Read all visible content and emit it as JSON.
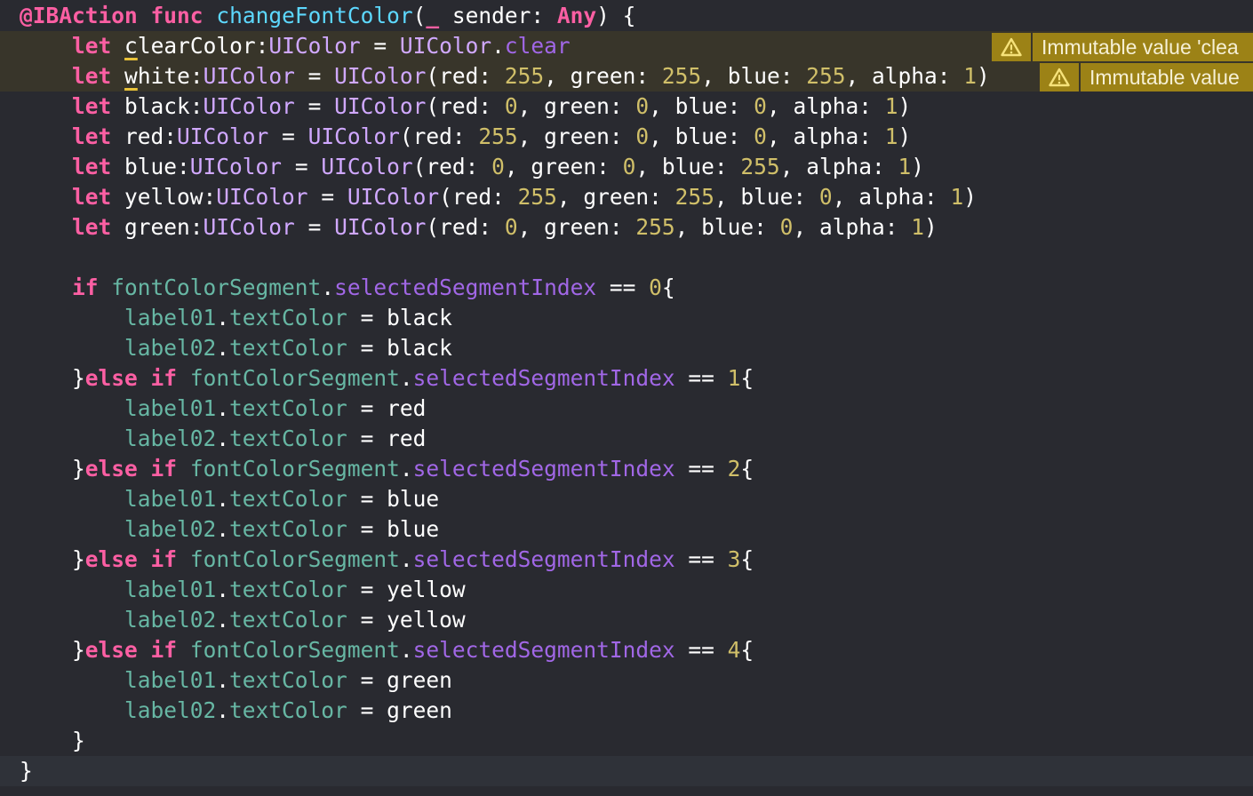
{
  "editor": {
    "lines": [
      [
        {
          "t": "@IBAction",
          "c": "attr"
        },
        {
          "t": " ",
          "c": "plain"
        },
        {
          "t": "func",
          "c": "kw"
        },
        {
          "t": " ",
          "c": "plain"
        },
        {
          "t": "changeFontColor",
          "c": "decl"
        },
        {
          "t": "(",
          "c": "plain"
        },
        {
          "t": "_",
          "c": "kw"
        },
        {
          "t": " sender: ",
          "c": "plain"
        },
        {
          "t": "Any",
          "c": "kw"
        },
        {
          "t": ") {",
          "c": "plain"
        }
      ],
      [
        {
          "t": "    ",
          "c": "plain"
        },
        {
          "t": "let",
          "c": "kw"
        },
        {
          "t": " ",
          "c": "plain"
        },
        {
          "t": "c",
          "c": "u"
        },
        {
          "t": "learColor:",
          "c": "plain"
        },
        {
          "t": "UIColor",
          "c": "type"
        },
        {
          "t": " = ",
          "c": "plain"
        },
        {
          "t": "UIColor",
          "c": "type"
        },
        {
          "t": ".",
          "c": "plain"
        },
        {
          "t": "clear",
          "c": "prop"
        }
      ],
      [
        {
          "t": "    ",
          "c": "plain"
        },
        {
          "t": "let",
          "c": "kw"
        },
        {
          "t": " ",
          "c": "plain"
        },
        {
          "t": "w",
          "c": "u"
        },
        {
          "t": "hite:",
          "c": "plain"
        },
        {
          "t": "UIColor",
          "c": "type"
        },
        {
          "t": " = ",
          "c": "plain"
        },
        {
          "t": "UIColor",
          "c": "type"
        },
        {
          "t": "(red: ",
          "c": "plain"
        },
        {
          "t": "255",
          "c": "num"
        },
        {
          "t": ", green: ",
          "c": "plain"
        },
        {
          "t": "255",
          "c": "num"
        },
        {
          "t": ", blue: ",
          "c": "plain"
        },
        {
          "t": "255",
          "c": "num"
        },
        {
          "t": ", alpha: ",
          "c": "plain"
        },
        {
          "t": "1",
          "c": "num"
        },
        {
          "t": ")",
          "c": "plain"
        }
      ],
      [
        {
          "t": "    ",
          "c": "plain"
        },
        {
          "t": "let",
          "c": "kw"
        },
        {
          "t": " black:",
          "c": "plain"
        },
        {
          "t": "UIColor",
          "c": "type"
        },
        {
          "t": " = ",
          "c": "plain"
        },
        {
          "t": "UIColor",
          "c": "type"
        },
        {
          "t": "(red: ",
          "c": "plain"
        },
        {
          "t": "0",
          "c": "num"
        },
        {
          "t": ", green: ",
          "c": "plain"
        },
        {
          "t": "0",
          "c": "num"
        },
        {
          "t": ", blue: ",
          "c": "plain"
        },
        {
          "t": "0",
          "c": "num"
        },
        {
          "t": ", alpha: ",
          "c": "plain"
        },
        {
          "t": "1",
          "c": "num"
        },
        {
          "t": ")",
          "c": "plain"
        }
      ],
      [
        {
          "t": "    ",
          "c": "plain"
        },
        {
          "t": "let",
          "c": "kw"
        },
        {
          "t": " red:",
          "c": "plain"
        },
        {
          "t": "UIColor",
          "c": "type"
        },
        {
          "t": " = ",
          "c": "plain"
        },
        {
          "t": "UIColor",
          "c": "type"
        },
        {
          "t": "(red: ",
          "c": "plain"
        },
        {
          "t": "255",
          "c": "num"
        },
        {
          "t": ", green: ",
          "c": "plain"
        },
        {
          "t": "0",
          "c": "num"
        },
        {
          "t": ", blue: ",
          "c": "plain"
        },
        {
          "t": "0",
          "c": "num"
        },
        {
          "t": ", alpha: ",
          "c": "plain"
        },
        {
          "t": "1",
          "c": "num"
        },
        {
          "t": ")",
          "c": "plain"
        }
      ],
      [
        {
          "t": "    ",
          "c": "plain"
        },
        {
          "t": "let",
          "c": "kw"
        },
        {
          "t": " blue:",
          "c": "plain"
        },
        {
          "t": "UIColor",
          "c": "type"
        },
        {
          "t": " = ",
          "c": "plain"
        },
        {
          "t": "UIColor",
          "c": "type"
        },
        {
          "t": "(red: ",
          "c": "plain"
        },
        {
          "t": "0",
          "c": "num"
        },
        {
          "t": ", green: ",
          "c": "plain"
        },
        {
          "t": "0",
          "c": "num"
        },
        {
          "t": ", blue: ",
          "c": "plain"
        },
        {
          "t": "255",
          "c": "num"
        },
        {
          "t": ", alpha: ",
          "c": "plain"
        },
        {
          "t": "1",
          "c": "num"
        },
        {
          "t": ")",
          "c": "plain"
        }
      ],
      [
        {
          "t": "    ",
          "c": "plain"
        },
        {
          "t": "let",
          "c": "kw"
        },
        {
          "t": " yellow:",
          "c": "plain"
        },
        {
          "t": "UIColor",
          "c": "type"
        },
        {
          "t": " = ",
          "c": "plain"
        },
        {
          "t": "UIColor",
          "c": "type"
        },
        {
          "t": "(red: ",
          "c": "plain"
        },
        {
          "t": "255",
          "c": "num"
        },
        {
          "t": ", green: ",
          "c": "plain"
        },
        {
          "t": "255",
          "c": "num"
        },
        {
          "t": ", blue: ",
          "c": "plain"
        },
        {
          "t": "0",
          "c": "num"
        },
        {
          "t": ", alpha: ",
          "c": "plain"
        },
        {
          "t": "1",
          "c": "num"
        },
        {
          "t": ")",
          "c": "plain"
        }
      ],
      [
        {
          "t": "    ",
          "c": "plain"
        },
        {
          "t": "let",
          "c": "kw"
        },
        {
          "t": " green:",
          "c": "plain"
        },
        {
          "t": "UIColor",
          "c": "type"
        },
        {
          "t": " = ",
          "c": "plain"
        },
        {
          "t": "UIColor",
          "c": "type"
        },
        {
          "t": "(red: ",
          "c": "plain"
        },
        {
          "t": "0",
          "c": "num"
        },
        {
          "t": ", green: ",
          "c": "plain"
        },
        {
          "t": "255",
          "c": "num"
        },
        {
          "t": ", blue: ",
          "c": "plain"
        },
        {
          "t": "0",
          "c": "num"
        },
        {
          "t": ", alpha: ",
          "c": "plain"
        },
        {
          "t": "1",
          "c": "num"
        },
        {
          "t": ")",
          "c": "plain"
        }
      ],
      [],
      [
        {
          "t": "    ",
          "c": "plain"
        },
        {
          "t": "if",
          "c": "kw"
        },
        {
          "t": " ",
          "c": "plain"
        },
        {
          "t": "fontColorSegment",
          "c": "var"
        },
        {
          "t": ".",
          "c": "plain"
        },
        {
          "t": "selectedSegmentIndex",
          "c": "prop"
        },
        {
          "t": " == ",
          "c": "plain"
        },
        {
          "t": "0",
          "c": "num"
        },
        {
          "t": "{",
          "c": "plain"
        }
      ],
      [
        {
          "t": "        ",
          "c": "plain"
        },
        {
          "t": "label01",
          "c": "var"
        },
        {
          "t": ".",
          "c": "plain"
        },
        {
          "t": "textColor",
          "c": "var"
        },
        {
          "t": " = black",
          "c": "plain"
        }
      ],
      [
        {
          "t": "        ",
          "c": "plain"
        },
        {
          "t": "label02",
          "c": "var"
        },
        {
          "t": ".",
          "c": "plain"
        },
        {
          "t": "textColor",
          "c": "var"
        },
        {
          "t": " = black",
          "c": "plain"
        }
      ],
      [
        {
          "t": "    }",
          "c": "plain"
        },
        {
          "t": "else",
          "c": "kw"
        },
        {
          "t": " ",
          "c": "plain"
        },
        {
          "t": "if",
          "c": "kw"
        },
        {
          "t": " ",
          "c": "plain"
        },
        {
          "t": "fontColorSegment",
          "c": "var"
        },
        {
          "t": ".",
          "c": "plain"
        },
        {
          "t": "selectedSegmentIndex",
          "c": "prop"
        },
        {
          "t": " == ",
          "c": "plain"
        },
        {
          "t": "1",
          "c": "num"
        },
        {
          "t": "{",
          "c": "plain"
        }
      ],
      [
        {
          "t": "        ",
          "c": "plain"
        },
        {
          "t": "label01",
          "c": "var"
        },
        {
          "t": ".",
          "c": "plain"
        },
        {
          "t": "textColor",
          "c": "var"
        },
        {
          "t": " = red",
          "c": "plain"
        }
      ],
      [
        {
          "t": "        ",
          "c": "plain"
        },
        {
          "t": "label02",
          "c": "var"
        },
        {
          "t": ".",
          "c": "plain"
        },
        {
          "t": "textColor",
          "c": "var"
        },
        {
          "t": " = red",
          "c": "plain"
        }
      ],
      [
        {
          "t": "    }",
          "c": "plain"
        },
        {
          "t": "else",
          "c": "kw"
        },
        {
          "t": " ",
          "c": "plain"
        },
        {
          "t": "if",
          "c": "kw"
        },
        {
          "t": " ",
          "c": "plain"
        },
        {
          "t": "fontColorSegment",
          "c": "var"
        },
        {
          "t": ".",
          "c": "plain"
        },
        {
          "t": "selectedSegmentIndex",
          "c": "prop"
        },
        {
          "t": " == ",
          "c": "plain"
        },
        {
          "t": "2",
          "c": "num"
        },
        {
          "t": "{",
          "c": "plain"
        }
      ],
      [
        {
          "t": "        ",
          "c": "plain"
        },
        {
          "t": "label01",
          "c": "var"
        },
        {
          "t": ".",
          "c": "plain"
        },
        {
          "t": "textColor",
          "c": "var"
        },
        {
          "t": " = blue",
          "c": "plain"
        }
      ],
      [
        {
          "t": "        ",
          "c": "plain"
        },
        {
          "t": "label02",
          "c": "var"
        },
        {
          "t": ".",
          "c": "plain"
        },
        {
          "t": "textColor",
          "c": "var"
        },
        {
          "t": " = blue",
          "c": "plain"
        }
      ],
      [
        {
          "t": "    }",
          "c": "plain"
        },
        {
          "t": "else",
          "c": "kw"
        },
        {
          "t": " ",
          "c": "plain"
        },
        {
          "t": "if",
          "c": "kw"
        },
        {
          "t": " ",
          "c": "plain"
        },
        {
          "t": "fontColorSegment",
          "c": "var"
        },
        {
          "t": ".",
          "c": "plain"
        },
        {
          "t": "selectedSegmentIndex",
          "c": "prop"
        },
        {
          "t": " == ",
          "c": "plain"
        },
        {
          "t": "3",
          "c": "num"
        },
        {
          "t": "{",
          "c": "plain"
        }
      ],
      [
        {
          "t": "        ",
          "c": "plain"
        },
        {
          "t": "label01",
          "c": "var"
        },
        {
          "t": ".",
          "c": "plain"
        },
        {
          "t": "textColor",
          "c": "var"
        },
        {
          "t": " = yellow",
          "c": "plain"
        }
      ],
      [
        {
          "t": "        ",
          "c": "plain"
        },
        {
          "t": "label02",
          "c": "var"
        },
        {
          "t": ".",
          "c": "plain"
        },
        {
          "t": "textColor",
          "c": "var"
        },
        {
          "t": " = yellow",
          "c": "plain"
        }
      ],
      [
        {
          "t": "    }",
          "c": "plain"
        },
        {
          "t": "else",
          "c": "kw"
        },
        {
          "t": " ",
          "c": "plain"
        },
        {
          "t": "if",
          "c": "kw"
        },
        {
          "t": " ",
          "c": "plain"
        },
        {
          "t": "fontColorSegment",
          "c": "var"
        },
        {
          "t": ".",
          "c": "plain"
        },
        {
          "t": "selectedSegmentIndex",
          "c": "prop"
        },
        {
          "t": " == ",
          "c": "plain"
        },
        {
          "t": "4",
          "c": "num"
        },
        {
          "t": "{",
          "c": "plain"
        }
      ],
      [
        {
          "t": "        ",
          "c": "plain"
        },
        {
          "t": "label01",
          "c": "var"
        },
        {
          "t": ".",
          "c": "plain"
        },
        {
          "t": "textColor",
          "c": "var"
        },
        {
          "t": " = green",
          "c": "plain"
        }
      ],
      [
        {
          "t": "        ",
          "c": "plain"
        },
        {
          "t": "label02",
          "c": "var"
        },
        {
          "t": ".",
          "c": "plain"
        },
        {
          "t": "textColor",
          "c": "var"
        },
        {
          "t": " = green",
          "c": "plain"
        }
      ],
      [
        {
          "t": "    }",
          "c": "plain"
        }
      ],
      [
        {
          "t": "}",
          "c": "plain"
        }
      ]
    ],
    "warning_lines": [
      1,
      2
    ],
    "current_line": 25
  },
  "issues": [
    {
      "line": 1,
      "icon": "warning-triangle-icon",
      "text": "Immutable value 'clea"
    },
    {
      "line": 2,
      "icon": "warning-triangle-icon",
      "text": "Immutable value"
    }
  ],
  "colors": {
    "background": "#292a30",
    "warning_badge": "#9c8216",
    "keyword": "#fc5fa3",
    "type": "#d0a8ff",
    "number": "#d0bf69",
    "identifier": "#67b7a4",
    "property": "#a167e6",
    "declaration": "#5dd8ff"
  }
}
